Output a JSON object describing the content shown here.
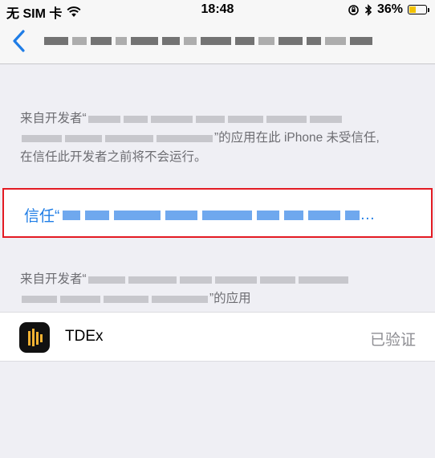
{
  "status_bar": {
    "carrier": "无 SIM 卡",
    "time": "18:48",
    "battery": "36%"
  },
  "nav": {
    "back_icon": "chevron-left-icon"
  },
  "notice": {
    "line1_prefix": "来自开发者“",
    "line2_suffix": "”的应用在此 iPhone 未受信任,",
    "line3": "在信任此开发者之前将不会运行。"
  },
  "trust": {
    "label": "信任“",
    "ellipsis": "…"
  },
  "apps_notice": {
    "line1_prefix": "来自开发者“",
    "line2_suffix": "”的应用"
  },
  "app": {
    "name": "TDEx",
    "status": "已验证"
  },
  "colors": {
    "accent": "#1f7de6",
    "highlight_border": "#e31b23",
    "battery_fill": "#f2c200"
  }
}
